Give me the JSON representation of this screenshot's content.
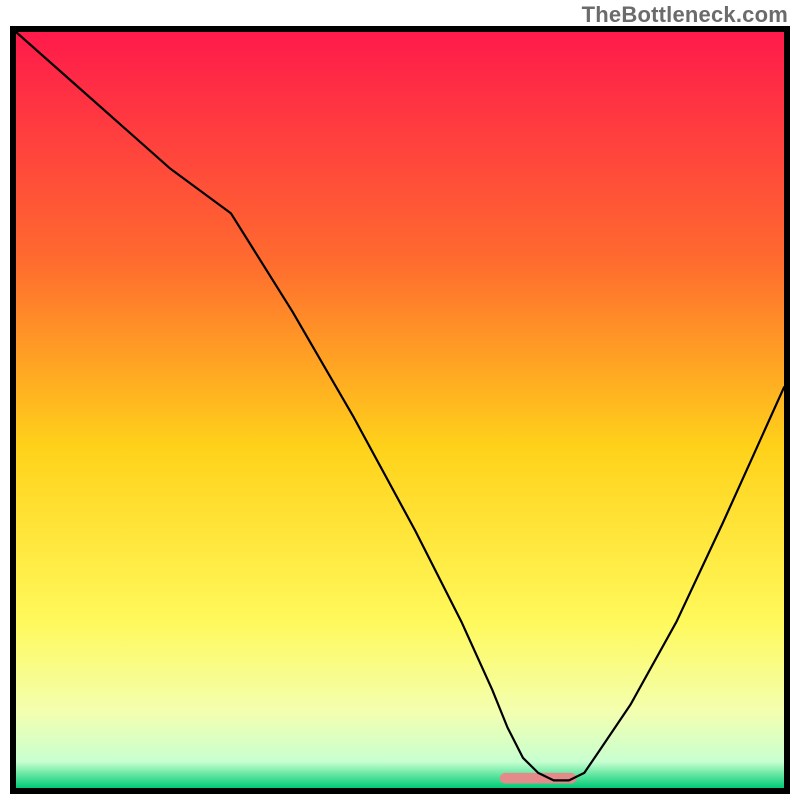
{
  "watermark": "TheBottleneck.com",
  "chart_data": {
    "type": "line",
    "title": "",
    "xlabel": "",
    "ylabel": "",
    "xlim": [
      0,
      100
    ],
    "ylim": [
      0,
      100
    ],
    "grid": false,
    "legend": false,
    "background_gradient": {
      "direction": "vertical",
      "stops": [
        {
          "pos": 0.0,
          "color": "#ff1a4b"
        },
        {
          "pos": 0.3,
          "color": "#ff6a2f"
        },
        {
          "pos": 0.55,
          "color": "#ffd21a"
        },
        {
          "pos": 0.78,
          "color": "#fff95c"
        },
        {
          "pos": 0.9,
          "color": "#f3ffb0"
        },
        {
          "pos": 0.965,
          "color": "#c8ffd0"
        },
        {
          "pos": 0.985,
          "color": "#54e29a"
        },
        {
          "pos": 1.0,
          "color": "#00c977"
        }
      ]
    },
    "series": [
      {
        "name": "bottleneck-curve",
        "color": "#000000",
        "stroke_width": 2.2,
        "x": [
          0,
          10,
          20,
          28,
          36,
          44,
          52,
          58,
          62,
          64,
          66,
          68,
          70,
          72,
          74,
          76,
          80,
          86,
          92,
          96,
          100
        ],
        "values": [
          100,
          91,
          82,
          76,
          63,
          49,
          34,
          22,
          13,
          8,
          4,
          2,
          1,
          1,
          2,
          5,
          11,
          22,
          35,
          44,
          53
        ]
      }
    ],
    "annotations": [
      {
        "type": "marker-bar",
        "name": "optimal-range-bar",
        "x_center": 68,
        "x_width": 10,
        "y": 0.6,
        "height": 1.4,
        "color": "#e58a8a",
        "radius": 6
      }
    ]
  }
}
